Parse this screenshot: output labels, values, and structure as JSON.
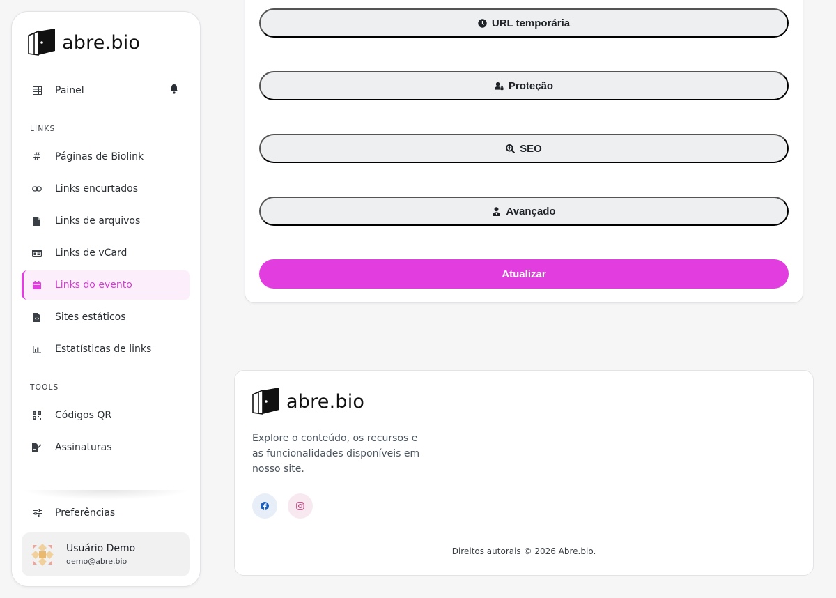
{
  "brand": {
    "name": "abre.bio"
  },
  "sidebar": {
    "dashboard": {
      "label": "Painel",
      "icon": "table-icon"
    },
    "links_section": "LINKS",
    "links": [
      {
        "label": "Páginas de Biolink",
        "icon": "hash-icon"
      },
      {
        "label": "Links encurtados",
        "icon": "link-icon"
      },
      {
        "label": "Links de arquivos",
        "icon": "file-icon"
      },
      {
        "label": "Links de vCard",
        "icon": "id-card-icon"
      },
      {
        "label": "Links do evento",
        "icon": "calendar-icon",
        "active": true
      },
      {
        "label": "Sites estáticos",
        "icon": "file-code-icon"
      },
      {
        "label": "Estatísticas de links",
        "icon": "chart-icon"
      }
    ],
    "tools_section": "TOOLS",
    "tools": [
      {
        "label": "Códigos QR",
        "icon": "qr-icon"
      },
      {
        "label": "Assinaturas",
        "icon": "signature-icon"
      }
    ],
    "preferences": {
      "label": "Preferências",
      "icon": "sliders-icon"
    },
    "user": {
      "name": "Usuário Demo",
      "email": "demo@abre.bio"
    }
  },
  "main": {
    "sections": [
      {
        "label": "URL temporária",
        "icon": "clock-icon"
      },
      {
        "label": "Proteção",
        "icon": "user-lock-icon"
      },
      {
        "label": "SEO",
        "icon": "search-icon"
      },
      {
        "label": "Avançado",
        "icon": "user-tie-icon"
      }
    ],
    "submit_label": "Atualizar"
  },
  "footer": {
    "description": "Explore o conteúdo, os recursos e as funcionalidades disponíveis em nosso site.",
    "copyright": "Direitos autorais © 2026 Abre.bio."
  },
  "colors": {
    "accent": "#e23ddf",
    "accent_bg": "#fdeefc"
  }
}
